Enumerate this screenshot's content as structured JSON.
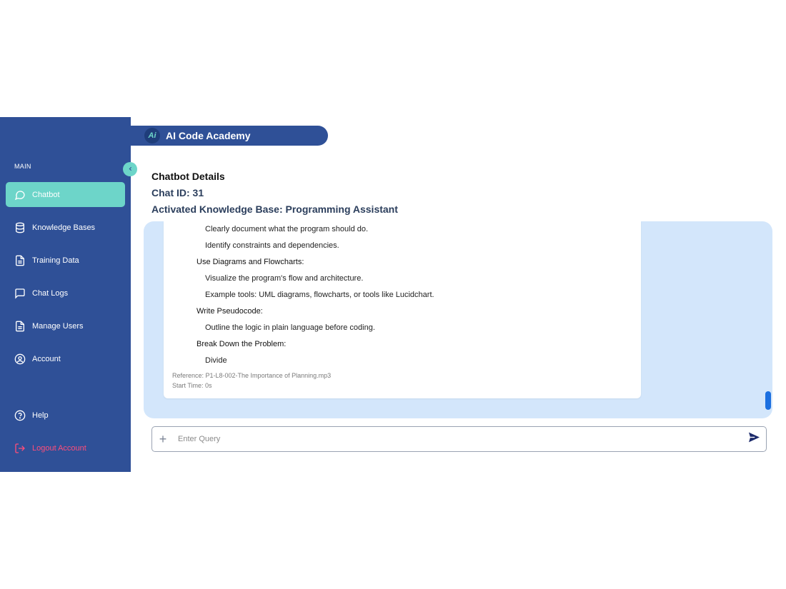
{
  "app": {
    "title": "AI Code Academy",
    "logo_text": "Ai"
  },
  "sidebar": {
    "section_label": "MAIN",
    "items": [
      {
        "label": "Chatbot",
        "icon": "chat-bubble-icon",
        "active": true
      },
      {
        "label": "Knowledge Bases",
        "icon": "database-icon"
      },
      {
        "label": "Training Data",
        "icon": "document-icon"
      },
      {
        "label": "Chat Logs",
        "icon": "message-square-icon"
      },
      {
        "label": "Manage Users",
        "icon": "document-icon"
      },
      {
        "label": "Account",
        "icon": "user-circle-icon"
      }
    ],
    "bottom_items": [
      {
        "label": "Help",
        "icon": "help-circle-icon"
      },
      {
        "label": "Logout Account",
        "icon": "logout-icon"
      }
    ]
  },
  "details": {
    "title": "Chatbot Details",
    "chat_id": "Chat ID: 31",
    "knowledge_base": "Activated Knowledge Base: Programming Assistant"
  },
  "message": {
    "lines": [
      "Clearly document what the program should do.",
      "Identify constraints and dependencies.",
      "Use Diagrams and Flowcharts:",
      "Visualize the program's flow and architecture.",
      "Example tools: UML diagrams, flowcharts, or tools like Lucidchart.",
      "Write Pseudocode:",
      "Outline the logic in plain language before coding.",
      "Break Down the Problem:",
      "Divide"
    ],
    "reference": "Reference: P1-L8-002-The Importance of Planning.mp3",
    "start_time": "Start Time: 0s"
  },
  "query": {
    "placeholder": "Enter Query",
    "value": ""
  },
  "colors": {
    "sidebar": "#2f5097",
    "accent": "#6dd5c9",
    "panel": "#d3e6fb",
    "logout": "#ff4d7a",
    "scroll": "#1b6fe0"
  }
}
